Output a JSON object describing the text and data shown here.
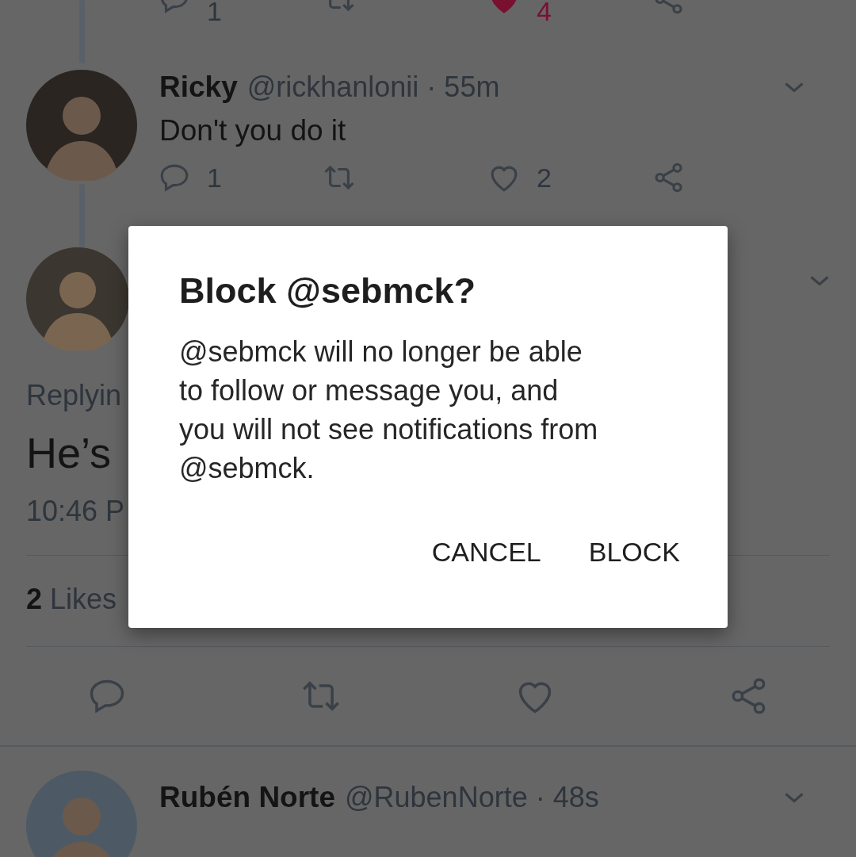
{
  "top_actions": {
    "reply_count": "1",
    "like_count": "4",
    "liked": true
  },
  "tweet": {
    "name": "Ricky",
    "handle": "@rickhanlonii · 55m",
    "text": "Don't you do it",
    "reply_count": "1",
    "like_count": "2",
    "liked": false
  },
  "focused_tweet": {
    "replying": "Replyin",
    "text": "He’s",
    "timestamp": "10:46 P",
    "likes_count": "2",
    "likes_label": "Likes",
    "liked": false
  },
  "next_tweet": {
    "name": "Rubén Norte",
    "handle": "@RubenNorte · 48s"
  },
  "dialog": {
    "title": "Block @sebmck?",
    "message_lines": [
      "@sebmck will no longer be able",
      "to follow or message you, and",
      "you will not see notifications from",
      "@sebmck."
    ],
    "buttons": [
      "CANCEL",
      "BLOCK"
    ]
  }
}
